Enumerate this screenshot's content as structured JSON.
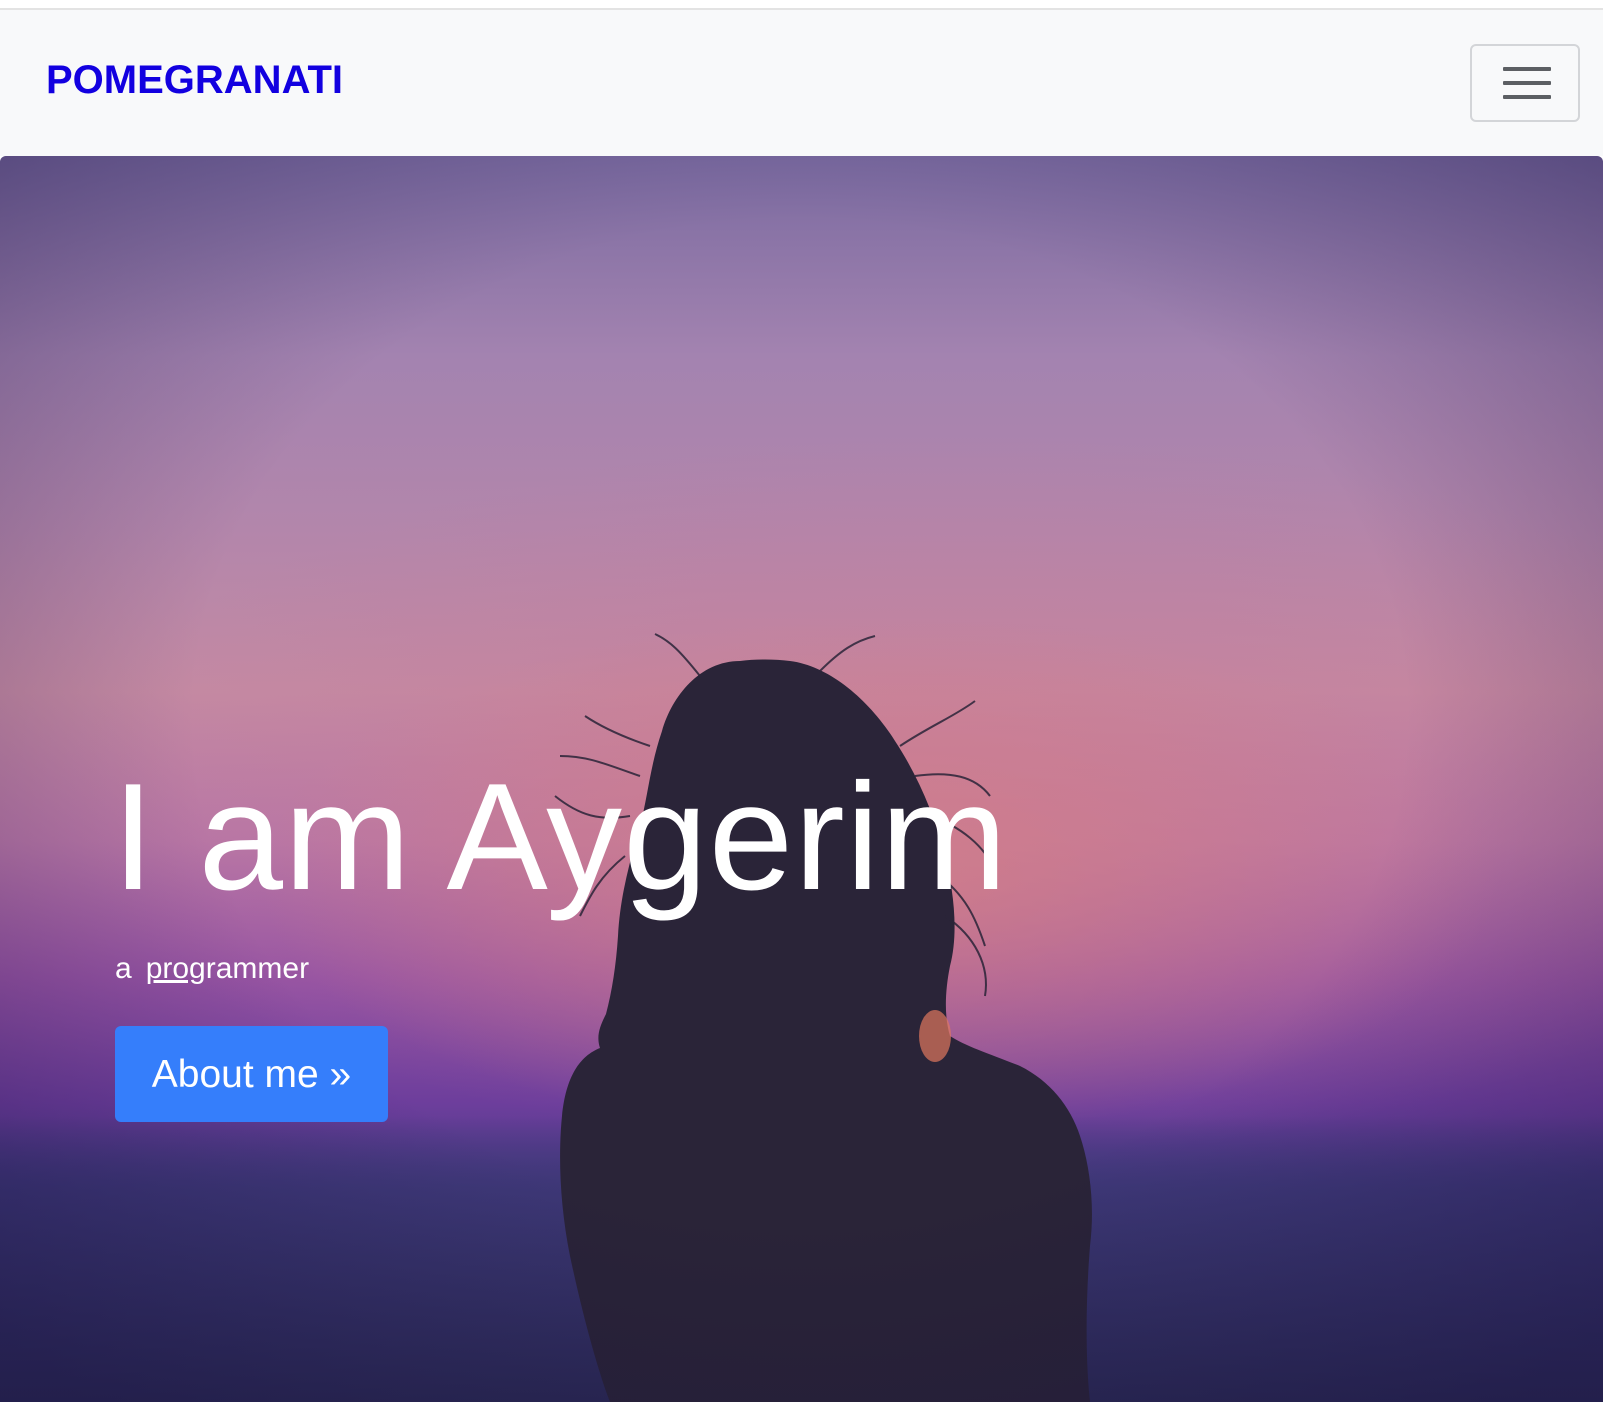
{
  "navbar": {
    "brand": "POMEGRANATI",
    "brand_color": "#1200e0",
    "toggler_icon": "hamburger-menu-icon"
  },
  "hero": {
    "title": "I am Aygerim",
    "subtitle_prefix": "a",
    "subtitle_underlined": "prog",
    "subtitle_rest": "rammer",
    "button_label": "About me »",
    "button_color": "#357efb",
    "background_image": "sunset-silhouette-photo"
  }
}
